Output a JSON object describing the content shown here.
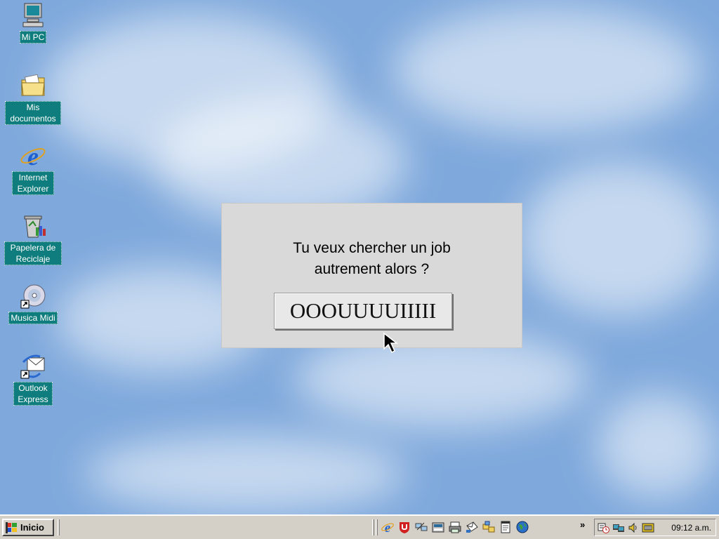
{
  "desktop": {
    "icons": [
      {
        "label": "Mi PC",
        "icon": "my-computer-icon"
      },
      {
        "label": "Mis documentos",
        "icon": "folder-documents-icon"
      },
      {
        "label": "Internet Explorer",
        "icon": "internet-explorer-icon"
      },
      {
        "label": "Papelera de Reciclaje",
        "icon": "recycle-bin-icon"
      },
      {
        "label": "Musica Midi",
        "icon": "cd-shortcut-icon"
      },
      {
        "label": "Outlook Express",
        "icon": "outlook-express-icon"
      }
    ],
    "label_bg": "#0f7d7d",
    "sky_color": "#7fa9dc"
  },
  "dialog": {
    "question_line1": "Tu veux chercher un job",
    "question_line2": "autrement alors ?",
    "answer_button": "OOOUUUUIIIII",
    "bg": "#d9d9d9"
  },
  "taskbar": {
    "start_label": "Inicio",
    "quick_launch": [
      "internet-explorer-icon",
      "antivirus-icon",
      "network-icon",
      "calculator-icon",
      "printer-icon",
      "mail-icon",
      "explorer-icon",
      "notepad-icon",
      "globe-icon"
    ],
    "tray_icons": [
      "scheduler-icon",
      "network-monitor-icon",
      "volume-icon",
      "keyboard-icon"
    ],
    "clock": "09:12 a.m.",
    "bg": "#d4d0c8"
  }
}
